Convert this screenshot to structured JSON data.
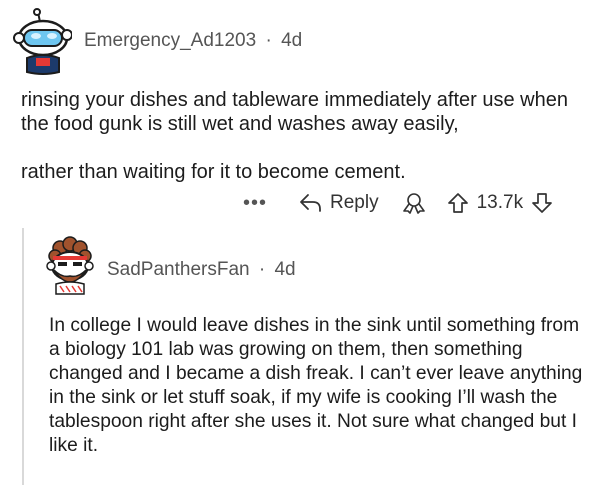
{
  "comment": {
    "username": "Emergency_Ad1203",
    "separator": "·",
    "age": "4d",
    "paragraphs": [
      "rinsing your dishes and tableware immediately after use when the food gunk is still wet and washes away easily,",
      "rather than waiting for it to become cement."
    ],
    "actions": {
      "more": "•••",
      "reply_label": "Reply",
      "score": "13.7k"
    }
  },
  "reply": {
    "username": "SadPanthersFan",
    "separator": "·",
    "age": "4d",
    "text": "In college I would leave dishes in the sink until something from a biology 101 lab was growing on them, then something changed and I became a dish freak. I can’t ever leave anything in the sink or let stuff soak, if my wife is cooking I’ll wash the tablespoon right after she uses it. Not sure what changed but I like it."
  },
  "icons": {
    "more": "more-options-icon",
    "reply": "reply-arrow-icon",
    "award": "award-icon",
    "upvote": "upvote-arrow-icon",
    "downvote": "downvote-arrow-icon"
  },
  "colors": {
    "text": "#1c1c1c",
    "meta": "#555555",
    "thread_line": "#d9d9d9"
  }
}
